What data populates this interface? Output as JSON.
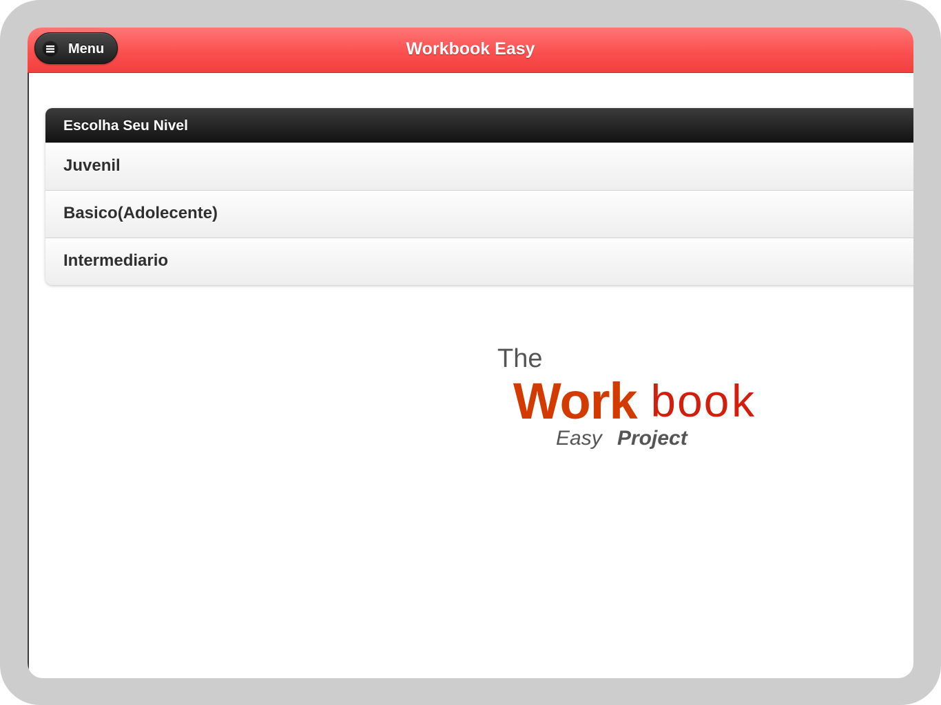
{
  "header": {
    "menu_label": "Menu",
    "menu_icon": "hamburger-icon",
    "title": "Workbook Easy"
  },
  "level_list": {
    "heading": "Escolha Seu Nivel",
    "items": [
      {
        "label": "Juvenil"
      },
      {
        "label": "Basico(Adolecente)"
      },
      {
        "label": "Intermediario"
      }
    ]
  },
  "logo": {
    "line1": "The",
    "word_bold": "Work",
    "word_light": "book",
    "tag_easy": "Easy",
    "tag_project": "Project"
  },
  "colors": {
    "header_red": "#fb5050",
    "logo_red": "#d23a00",
    "divider_black": "#1a1a1a"
  }
}
